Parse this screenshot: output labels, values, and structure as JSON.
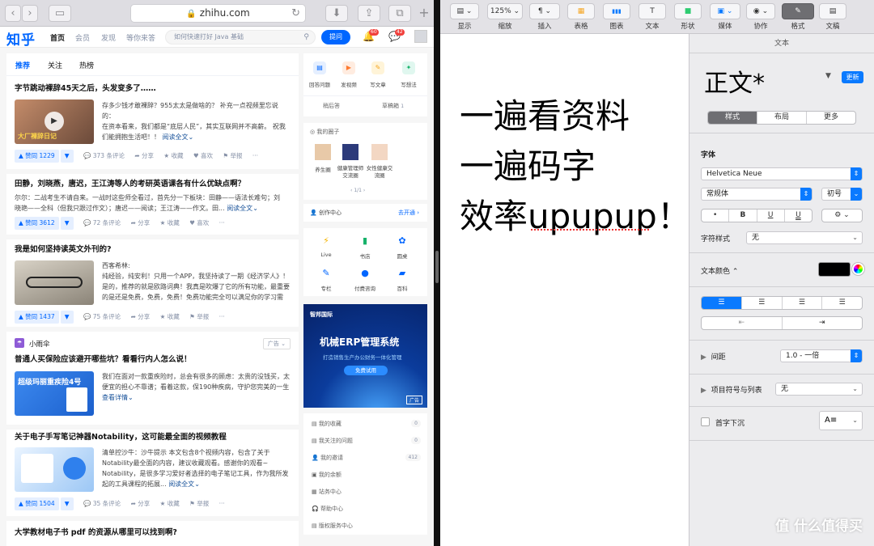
{
  "safari": {
    "url": "zhihu.com"
  },
  "zhihu": {
    "logo": "知乎",
    "nav": [
      "首页",
      "会员",
      "发现",
      "等你来答"
    ],
    "search_placeholder": "如何快速打好 Java 基础",
    "ask_label": "提问",
    "notif_badge": "60",
    "msg_badge": "42",
    "feed_tabs": [
      "推荐",
      "关注",
      "热榜"
    ],
    "cards": [
      {
        "title": "字节跳动裸辞45天之后，头发变多了……",
        "img_caption": "大厂裸辞日记",
        "excerpt_lines": [
          "存多少钱才敢裸辞？955太太是做啥的？ 补充一点视频里忘说的：",
          "在资本看来，我们都是“底层人民”，其实互联网并不高薪。 祝我",
          "们能拥抱生活吧！！"
        ],
        "read_more": "阅读全文",
        "vote": "▲ 赞同 1229",
        "comments": "373 条评论",
        "share": "分享",
        "fav": "收藏",
        "like": "喜欢",
        "report": "举报"
      },
      {
        "title": "田静，刘晓燕，唐迟，王江涛等人的考研英语课各有什么优缺点啊？",
        "excerpt_lines": [
          "尔尔：二战考生不请自来。一战时这些师全看过，首先分一下板块：田静——语法长难句；刘",
          "晓艳——全科（但我只跟过作文）；唐迟——阅读；王江涛——作文。田..."
        ],
        "read_more": "阅读全文",
        "vote": "▲ 赞同 3612",
        "comments": "72 条评论",
        "share": "分享",
        "fav": "收藏",
        "like": "喜欢"
      },
      {
        "title": "我是如何坚持读英文外刊的?",
        "excerpt_lines": [
          "西客希林:",
          "纯经验，纯安利！只用一个APP，我坚持读了一期《经济学人》！",
          "是的，推荐的就是欧路词典！我真是吹爆了它的所有功能，最重要",
          "的是还是免费，免费，免费！免费功能完全可以满足你的学习需"
        ],
        "vote": "▲ 赞同 1437",
        "comments": "75 条评论",
        "share": "分享",
        "fav": "收藏",
        "report": "举报"
      },
      {
        "author": "小雨伞",
        "ad_tag": "广告",
        "title": "普通人买保险应该避开哪些坑？看看行内人怎么说！",
        "img_caption": "超级玛丽重疾险4号",
        "excerpt_lines": [
          "我们在面对一款重疾险时，总会有很多的顾虑：太贵的没钱买，太",
          "便宜的担心不靠谱；看着这款，保190种疾病，守护您完美的一生"
        ],
        "read_more": "查看详情"
      },
      {
        "title": "关于电子手写笔记神器Notability，这可能最全面的视频教程",
        "excerpt_lines": [
          "清单控沙牛：沙牛提示 本文包含8个视频内容，包含了关于",
          "Notability最全面的内容，建议收藏观看。感谢你的观看~",
          "Notability，是很多学习爱好者选择的电子笔记工具，作为我所发",
          "起的工具课程的拓展..."
        ],
        "read_more": "阅读全文",
        "vote": "▲ 赞同 1504",
        "comments": "35 条评论",
        "share": "分享",
        "fav": "收藏",
        "report": "举报"
      },
      {
        "title": "大学教材电子书 pdf 的资源从哪里可以找到啊?"
      }
    ],
    "side": {
      "quick": [
        "回答问题",
        "发视频",
        "写文章",
        "写想法"
      ],
      "drafts": "稍后答",
      "draftbox": "草稿箱",
      "draft_count": "1",
      "circles_title": "我的圈子",
      "circles": [
        "养生圈",
        "健康管理师交流圈",
        "女性健康交流圈"
      ],
      "circle_page": "1/1",
      "creator": "创作中心",
      "creator_open": "去开通",
      "services": [
        "Live",
        "书店",
        "圆桌",
        "专栏",
        "付费咨询",
        "百科"
      ],
      "ad_brand": "智邦国际",
      "ad_title": "机械ERP管理系统",
      "ad_sub": "打造销售生产办公财务一体化管理",
      "ad_btn": "免费试用",
      "ad_tag": "广告",
      "links": [
        {
          "label": "我的收藏",
          "count": "0"
        },
        {
          "label": "我关注的问题",
          "count": "0"
        },
        {
          "label": "我的邀请",
          "count": "412"
        },
        {
          "label": "我的余额",
          "count": ""
        },
        {
          "label": "站务中心",
          "count": ""
        },
        {
          "label": "帮助中心",
          "count": ""
        },
        {
          "label": "版权服务中心",
          "count": ""
        }
      ]
    }
  },
  "pages": {
    "toolbar": [
      {
        "label": "显示",
        "btn": "▤ ⌄"
      },
      {
        "label": "缩放",
        "btn": "125% ⌄"
      },
      {
        "label": "插入",
        "btn": "¶ ⌄"
      },
      {
        "label": "表格",
        "btn": "▦"
      },
      {
        "label": "图表",
        "btn": "▮▮▮"
      },
      {
        "label": "文本",
        "btn": "T"
      },
      {
        "label": "形状",
        "btn": "■"
      },
      {
        "label": "媒体",
        "btn": "▣ ⌄"
      },
      {
        "label": "协作",
        "btn": "◉ ⌄"
      },
      {
        "label": "格式",
        "btn": "✎"
      },
      {
        "label": "文稿",
        "btn": "▤"
      }
    ],
    "doc_lines": [
      "一遍看资料",
      "一遍码字",
      "效率upupup！"
    ],
    "inspector": {
      "header": "文本",
      "style_name": "正文*",
      "update": "更新",
      "tabs": [
        "样式",
        "布局",
        "更多"
      ],
      "font_label": "字体",
      "font": "Helvetica Neue",
      "typeface": "常规体",
      "size": "初号",
      "fmt_buttons": [
        "•",
        "B",
        "U",
        "U",
        "⚙ ⌄"
      ],
      "char_style_label": "字符样式",
      "char_style": "无",
      "color_label": "文本颜色 ⌃",
      "spacing_label": "间距",
      "spacing": "1.0 - 一倍",
      "bullets_label": "项目符号与列表",
      "bullets": "无",
      "dropcap_label": "首字下沉"
    }
  },
  "watermark": "值 什么值得买",
  "colors": {
    "zhihu_blue": "#0066ff",
    "apple_blue": "#0a7aff"
  }
}
